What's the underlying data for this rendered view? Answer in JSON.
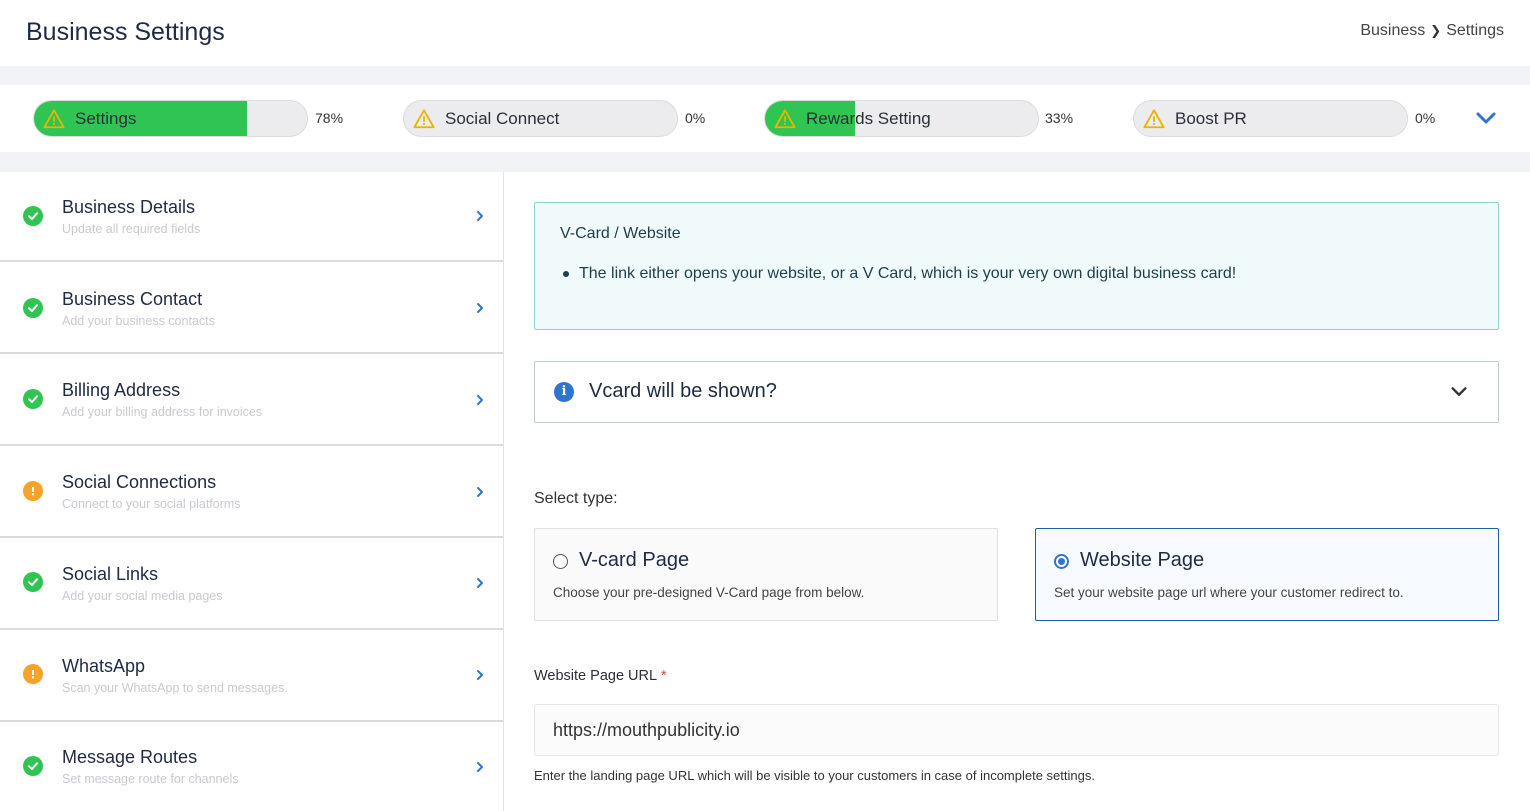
{
  "header": {
    "title": "Business Settings",
    "breadcrumb": {
      "first": "Business",
      "second": "Settings"
    }
  },
  "progress": [
    {
      "label": "Social Connect",
      "percent_text": "0%",
      "fill": 0
    }
  ],
  "progress_items": [
    {
      "label": "Settings",
      "percent_text": "78%",
      "fill": 0.78
    },
    {
      "label": "Social Connect",
      "percent_text": "0%",
      "fill": 0
    },
    {
      "label": "Rewards Setting",
      "percent_text": "33%",
      "fill": 0.33
    },
    {
      "label": "Boost PR",
      "percent_text": "0%",
      "fill": 0
    }
  ],
  "sidebar": {
    "items": [
      {
        "title": "Business Details",
        "subtitle": "Update all required fields",
        "status": "complete"
      },
      {
        "title": "Business Contact",
        "subtitle": "Add your business contacts",
        "status": "complete"
      },
      {
        "title": "Billing Address",
        "subtitle": "Add your billing address for invoices",
        "status": "complete"
      },
      {
        "title": "Social Connections",
        "subtitle": "Connect to your social platforms",
        "status": "warning"
      },
      {
        "title": "Social Links",
        "subtitle": "Add your social media pages",
        "status": "complete"
      },
      {
        "title": "WhatsApp",
        "subtitle": "Scan your WhatsApp to send messages.",
        "status": "warning"
      },
      {
        "title": "Message Routes",
        "subtitle": "Set message route for channels",
        "status": "complete"
      }
    ]
  },
  "main": {
    "info": {
      "title": "V-Card / Website",
      "bullet": "The link either opens your website, or a V Card, which is your very own digital business card!"
    },
    "accordion": {
      "title": "Vcard will be shown?"
    },
    "select_type_label": "Select type:",
    "types": [
      {
        "title": "V-card Page",
        "description": "Choose your pre-designed V-Card page from below.",
        "selected": false
      },
      {
        "title": "Website Page",
        "description": "Set your website page url where your customer redirect to.",
        "selected": true
      }
    ],
    "url": {
      "label": "Website Page URL",
      "required_mark": "*",
      "value": "https://mouthpublicity.io",
      "help": "Enter the landing page URL which will be visible to your customers in case of incomplete settings."
    }
  },
  "colors": {
    "progress_fill": "#30c553",
    "complete": "#30c553",
    "warning": "#f6a22b",
    "accent": "#2f74d0"
  }
}
